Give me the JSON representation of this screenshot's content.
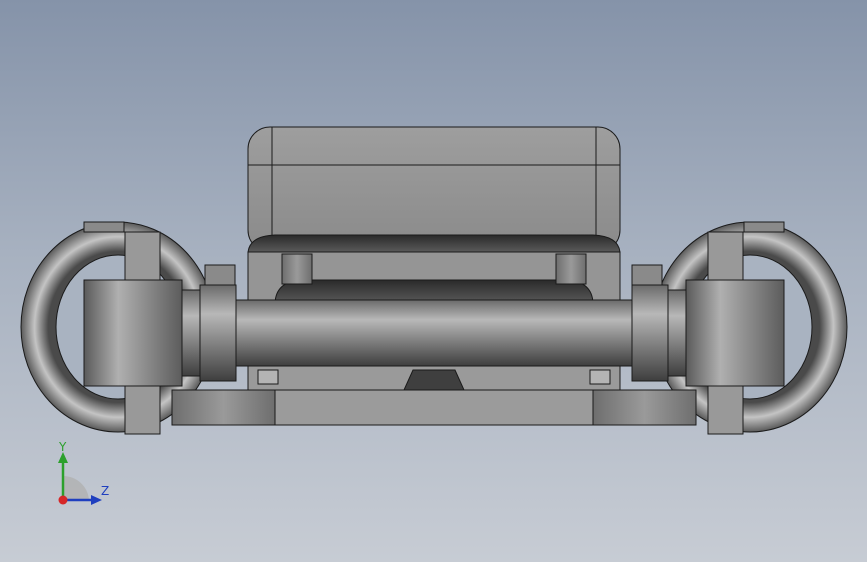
{
  "viewport": {
    "background_top": "#8593a9",
    "background_bottom": "#c7ccd4",
    "model_fill": "#8e8e8e",
    "model_edge": "#1a1a1a"
  },
  "triad": {
    "y_label": "Y",
    "z_label": "Z",
    "y_color": "#2ca02c",
    "z_color": "#1f3fbf",
    "x_color": "#d62728"
  }
}
